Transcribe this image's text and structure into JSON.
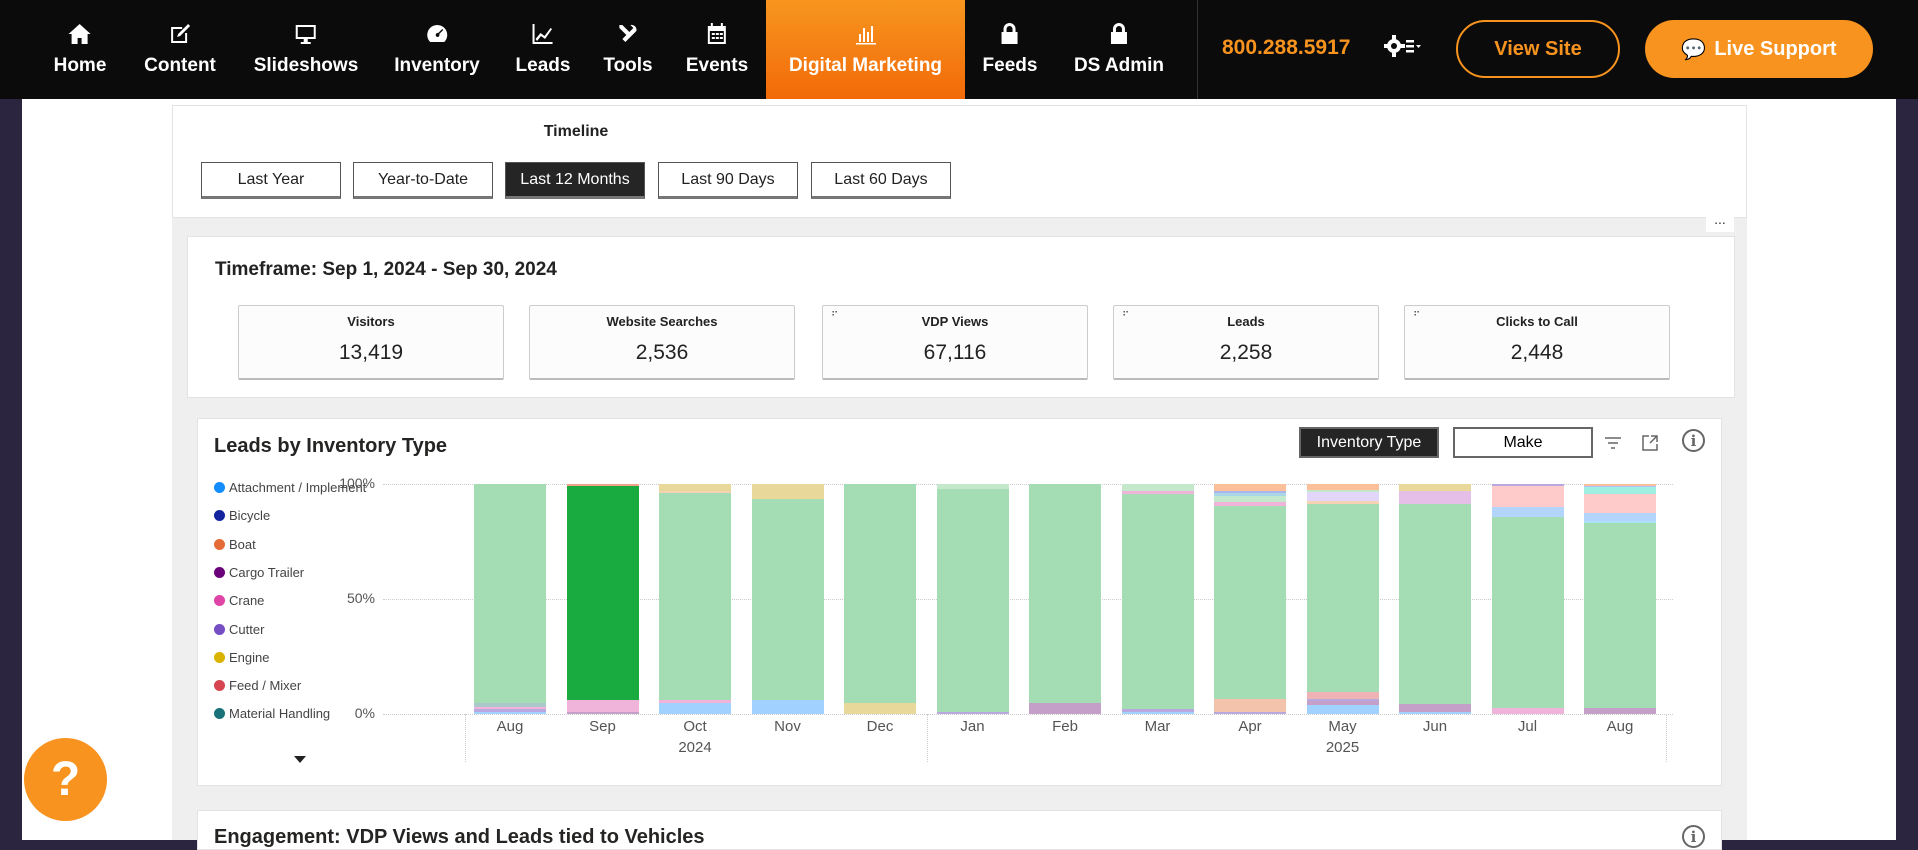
{
  "nav": {
    "items": [
      {
        "label": "Home",
        "icon": "home-icon"
      },
      {
        "label": "Content",
        "icon": "edit-icon"
      },
      {
        "label": "Slideshows",
        "icon": "monitor-icon"
      },
      {
        "label": "Inventory",
        "icon": "dashboard-icon"
      },
      {
        "label": "Leads",
        "icon": "chart-line-icon"
      },
      {
        "label": "Tools",
        "icon": "tools-icon"
      },
      {
        "label": "Events",
        "icon": "calendar-icon"
      },
      {
        "label": "Digital Marketing",
        "icon": "bar-chart-icon",
        "active": true
      },
      {
        "label": "Feeds",
        "icon": "lock-icon"
      },
      {
        "label": "DS Admin",
        "icon": "lock-icon"
      }
    ],
    "phone": "800.288.5917",
    "view_site": "View Site",
    "live_support": "Live Support",
    "accent": "#f7931e"
  },
  "timeline": {
    "title": "Timeline",
    "buttons": [
      "Last Year",
      "Year-to-Date",
      "Last 12 Months",
      "Last 90 Days",
      "Last 60 Days"
    ],
    "selected": "Last 12 Months"
  },
  "more_options": "...",
  "kpis": {
    "title": "Timeframe: Sep 1, 2024 - Sep 30, 2024",
    "items": [
      {
        "label": "Visitors",
        "value": "13,419"
      },
      {
        "label": "Website Searches",
        "value": "2,536"
      },
      {
        "label": "VDP Views",
        "value": "67,116"
      },
      {
        "label": "Leads",
        "value": "2,258"
      },
      {
        "label": "Clicks to Call",
        "value": "2,448"
      }
    ]
  },
  "leads_chart": {
    "title": "Leads by Inventory Type",
    "toggle": [
      "Inventory Type",
      "Make"
    ],
    "info": "i"
  },
  "chart_data": {
    "type": "bar",
    "stacked": true,
    "title": "Leads by Inventory Type",
    "legend": [
      {
        "name": "Attachment / Implement",
        "color": "#118dff"
      },
      {
        "name": "Bicycle",
        "color": "#12239e"
      },
      {
        "name": "Boat",
        "color": "#e66c37"
      },
      {
        "name": "Cargo Trailer",
        "color": "#6b007b"
      },
      {
        "name": "Crane",
        "color": "#e044a7"
      },
      {
        "name": "Cutter",
        "color": "#744ec2"
      },
      {
        "name": "Engine",
        "color": "#d9b300"
      },
      {
        "name": "Feed / Mixer",
        "color": "#d64550"
      },
      {
        "name": "Material Handling",
        "color": "#197278"
      }
    ],
    "y_ticks": [
      "100%",
      "50%",
      "0%"
    ],
    "ylim": [
      0,
      100
    ],
    "categories": [
      "Aug",
      "Sep",
      "Oct",
      "Nov",
      "Dec",
      "Jan",
      "Feb",
      "Mar",
      "Apr",
      "May",
      "Jun",
      "Jul",
      "Aug"
    ],
    "year_labels": [
      {
        "label": "2024",
        "under": "Oct"
      },
      {
        "label": "2025",
        "under": "May"
      }
    ],
    "bars": [
      [
        {
          "c": "#a0d1ff",
          "v": 1
        },
        {
          "c": "#b9a7e0",
          "v": 1
        },
        {
          "c": "#f0b3d9",
          "v": 1
        },
        {
          "c": "#a9c8c9",
          "v": 2
        },
        {
          "c": "#a4ddb3",
          "v": 95
        }
      ],
      [
        {
          "c": "#c49fc8",
          "v": 1
        },
        {
          "c": "#f0b3d9",
          "v": 5
        },
        {
          "c": "#1aab40",
          "v": 93
        },
        {
          "c": "#f2a38a",
          "v": 1
        }
      ],
      [
        {
          "c": "#a0d1ff",
          "v": 5
        },
        {
          "c": "#f0b3d9",
          "v": 1
        },
        {
          "c": "#a4ddb3",
          "v": 90
        },
        {
          "c": "#f6d2b5",
          "v": 1
        },
        {
          "c": "#e8d99b",
          "v": 3
        }
      ],
      [
        {
          "c": "#a0d1ff",
          "v": 6
        },
        {
          "c": "#a4ddb3",
          "v": 87.5
        },
        {
          "c": "#e8d99b",
          "v": 6.5
        }
      ],
      [
        {
          "c": "#e8d99b",
          "v": 5
        },
        {
          "c": "#a4ddb3",
          "v": 95
        }
      ],
      [
        {
          "c": "#b9a7e0",
          "v": 1
        },
        {
          "c": "#a4ddb3",
          "v": 97
        },
        {
          "c": "#c3e8cc",
          "v": 2
        }
      ],
      [
        {
          "c": "#c49fc8",
          "v": 5
        },
        {
          "c": "#a4ddb3",
          "v": 95
        }
      ],
      [
        {
          "c": "#a0d1ff",
          "v": 1
        },
        {
          "c": "#b9a7e0",
          "v": 1
        },
        {
          "c": "#a4ddb3",
          "v": 93.5
        },
        {
          "c": "#f0b3d9",
          "v": 1.5
        },
        {
          "c": "#c3e8cc",
          "v": 3
        }
      ],
      [
        {
          "c": "#b9a7e0",
          "v": 1
        },
        {
          "c": "#f3c3ab",
          "v": 5.5
        },
        {
          "c": "#a4ddb3",
          "v": 84
        },
        {
          "c": "#f0b3d9",
          "v": 1.5
        },
        {
          "c": "#c3e8cc",
          "v": 3
        },
        {
          "c": "#a9d6e8",
          "v": 1
        },
        {
          "c": "#a9b8e8",
          "v": 1
        },
        {
          "c": "#fbbf9a",
          "v": 3
        }
      ],
      [
        {
          "c": "#a0d1ff",
          "v": 4
        },
        {
          "c": "#c49fc8",
          "v": 1.5
        },
        {
          "c": "#b9a7e0",
          "v": 1
        },
        {
          "c": "#efb2b5",
          "v": 3
        },
        {
          "c": "#a4ddb3",
          "v": 82
        },
        {
          "c": "#f6d2b5",
          "v": 1
        },
        {
          "c": "#e2d7fb",
          "v": 4
        },
        {
          "c": "#c3e8cc",
          "v": 1
        },
        {
          "c": "#fbbf9a",
          "v": 2.5
        }
      ],
      [
        {
          "c": "#a0d1ff",
          "v": 1
        },
        {
          "c": "#c49fc8",
          "v": 3.5
        },
        {
          "c": "#a4ddb3",
          "v": 87
        },
        {
          "c": "#e5bfe8",
          "v": 5.5
        },
        {
          "c": "#e8d99b",
          "v": 3
        }
      ],
      [
        {
          "c": "#f0b3d9",
          "v": 2.5
        },
        {
          "c": "#a4ddb3",
          "v": 83
        },
        {
          "c": "#b3d4fb",
          "v": 4.5
        },
        {
          "c": "#fecaca",
          "v": 9
        },
        {
          "c": "#b9a7e0",
          "v": 1
        }
      ],
      [
        {
          "c": "#c49fc8",
          "v": 2.5
        },
        {
          "c": "#a4ddb3",
          "v": 80.5
        },
        {
          "c": "#a9e1f6",
          "v": 1
        },
        {
          "c": "#b3d4fb",
          "v": 3.5
        },
        {
          "c": "#fecaca",
          "v": 8
        },
        {
          "c": "#9ff0e0",
          "v": 3
        },
        {
          "c": "#b3c4fb",
          "v": 0.5
        },
        {
          "c": "#fbbf9a",
          "v": 1
        }
      ]
    ]
  },
  "engagement": {
    "title": "Engagement: VDP Views and Leads tied to Vehicles",
    "info": "i"
  },
  "help": "?"
}
